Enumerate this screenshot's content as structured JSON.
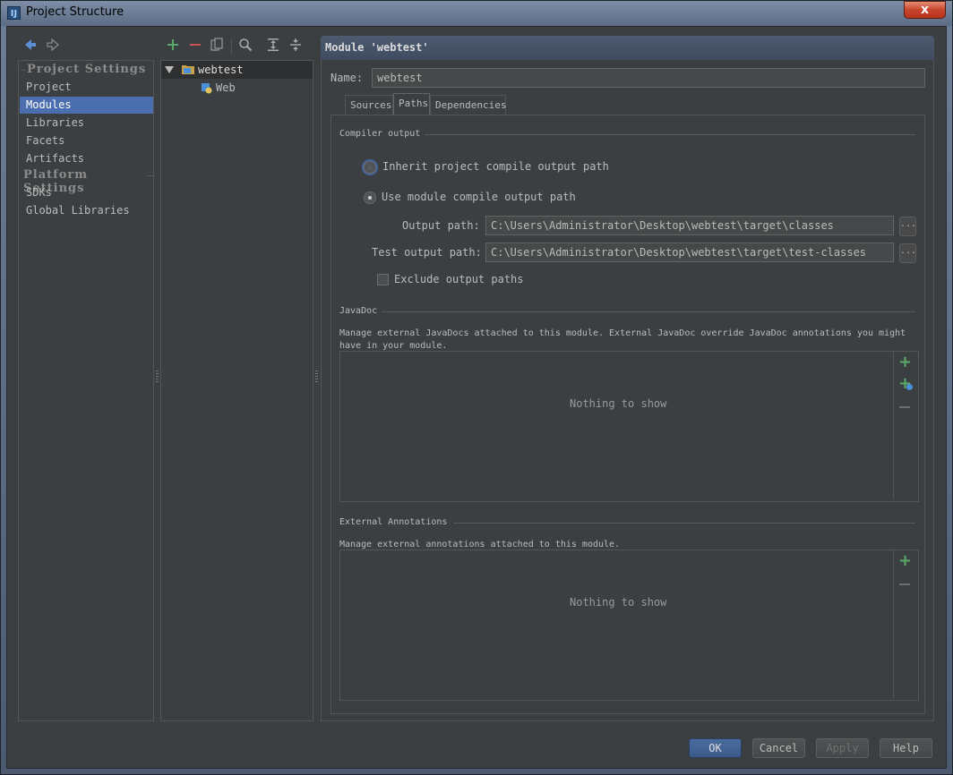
{
  "window": {
    "title": "Project Structure",
    "close_glyph": "x",
    "app_icon": "intellij-icon"
  },
  "nav_toolbar": {
    "back_icon": "back-arrow-icon",
    "forward_icon": "forward-arrow-icon"
  },
  "nav": {
    "project_settings_heading": "Project Settings",
    "project_items": [
      "Project",
      "Modules",
      "Libraries",
      "Facets",
      "Artifacts"
    ],
    "selected": "Modules",
    "platform_settings_heading": "Platform Settings",
    "platform_items": [
      "SDKs",
      "Global Libraries"
    ]
  },
  "tree_toolbar": {
    "add_icon": "plus-icon",
    "remove_icon": "minus-icon",
    "copy_icon": "copy-icon",
    "find_icon": "search-icon",
    "expand_icon": "expand-all-icon",
    "collapse_icon": "collapse-all-icon"
  },
  "tree": {
    "root": "webtest",
    "child": "Web",
    "colors": {
      "module": "#c7a14a",
      "web": "#4a8fd8"
    }
  },
  "module": {
    "header": "Module 'webtest'",
    "name_label": "Name:",
    "name_value": "webtest",
    "tabs": [
      "Sources",
      "Paths",
      "Dependencies"
    ],
    "active_tab": "Paths"
  },
  "paths": {
    "compiler_output_title": "Compiler output",
    "inherit_label": "Inherit project compile output path",
    "use_module_label": "Use module compile output path",
    "output_path_label": "Output path:",
    "output_path_value": "C:\\Users\\Administrator\\Desktop\\webtest\\target\\classes",
    "test_output_path_label": "Test output path:",
    "test_output_path_value": "C:\\Users\\Administrator\\Desktop\\webtest\\target\\test-classes",
    "browse_glyph": "...",
    "exclude_label": "Exclude output paths",
    "javadoc_title": "JavaDoc",
    "javadoc_desc_line1": "Manage external JavaDocs attached to this module. External JavaDoc override JavaDoc annotations you might",
    "javadoc_desc_line2": "have in your module.",
    "javadoc_empty": "Nothing to show",
    "annotations_title": "External Annotations",
    "annotations_desc": "Manage external annotations attached to this module.",
    "annotations_empty": "Nothing to show"
  },
  "buttons": {
    "ok": "OK",
    "cancel": "Cancel",
    "apply": "Apply",
    "help": "Help"
  }
}
